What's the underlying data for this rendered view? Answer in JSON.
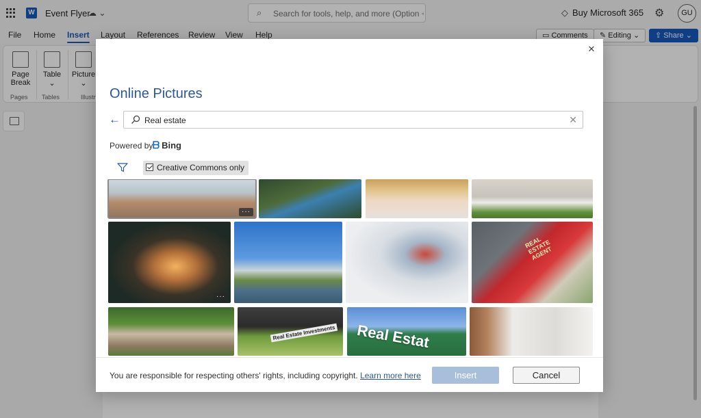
{
  "titlebar": {
    "doc_name": "Event Flyer",
    "search_placeholder": "Search for tools, help, and more (Option + Q)",
    "buy_label": "Buy Microsoft 365",
    "avatar_initials": "GU"
  },
  "menubar": {
    "tabs": [
      {
        "label": "File"
      },
      {
        "label": "Home"
      },
      {
        "label": "Insert"
      },
      {
        "label": "Layout"
      },
      {
        "label": "References"
      },
      {
        "label": "Review"
      },
      {
        "label": "View"
      },
      {
        "label": "Help"
      }
    ],
    "active_tab": "Insert",
    "comments_label": "Comments",
    "editing_label": "Editing",
    "share_label": "Share"
  },
  "ribbon": {
    "page_break_line1": "Page",
    "page_break_line2": "Break",
    "table_label": "Table",
    "picture_label": "Picture",
    "group_pages": "Pages",
    "group_tables": "Tables",
    "group_illustrations": "Illustr"
  },
  "dialog": {
    "title": "Online Pictures",
    "search_value": "Real estate",
    "powered_by": "Powered by",
    "bing_label": "Bing",
    "creative_commons_label": "Creative Commons only",
    "creative_commons_checked": true,
    "more_label": "···",
    "sign_text_1": "Real Estat",
    "sign_text_2": "REAL ESTATE AGENT",
    "sign_text_3": "Real Estate Investments",
    "footer_notice": "You are responsible for respecting others' rights, including copyright.",
    "learn_more": "Learn more here",
    "insert_label": "Insert",
    "cancel_label": "Cancel"
  },
  "colors": {
    "accent": "#185abd",
    "dialog_title": "#2b579a",
    "insert_disabled": "#a9bedb"
  }
}
